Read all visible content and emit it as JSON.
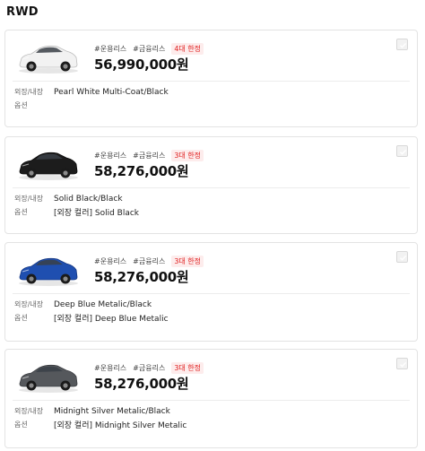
{
  "section_title": "RWD",
  "labels": {
    "exterior_interior": "외장/내장",
    "options": "옵션"
  },
  "cards": [
    {
      "car_color": "#f2f2f2",
      "car_stroke": "#bdbdbd",
      "tags": [
        "#운용리스",
        "#금융리스"
      ],
      "badge": "4대 한정",
      "price": "56,990,000원",
      "exterior_interior": "Pearl White Multi-Coat/Black",
      "options": ""
    },
    {
      "car_color": "#1c1c1c",
      "car_stroke": "#0a0a0a",
      "tags": [
        "#운용리스",
        "#금융리스"
      ],
      "badge": "3대 한정",
      "price": "58,276,000원",
      "exterior_interior": "Solid Black/Black",
      "options": "[외장 컬러] Solid Black"
    },
    {
      "car_color": "#1f4fb0",
      "car_stroke": "#143680",
      "tags": [
        "#운용리스",
        "#금융리스"
      ],
      "badge": "3대 한정",
      "price": "58,276,000원",
      "exterior_interior": "Deep Blue Metalic/Black",
      "options": "[외장 컬러] Deep Blue Metalic"
    },
    {
      "car_color": "#55585c",
      "car_stroke": "#3a3c40",
      "tags": [
        "#운용리스",
        "#금융리스"
      ],
      "badge": "3대 한정",
      "price": "58,276,000원",
      "exterior_interior": "Midnight Silver Metalic/Black",
      "options": "[외장 컬러] Midnight Silver Metalic"
    }
  ]
}
